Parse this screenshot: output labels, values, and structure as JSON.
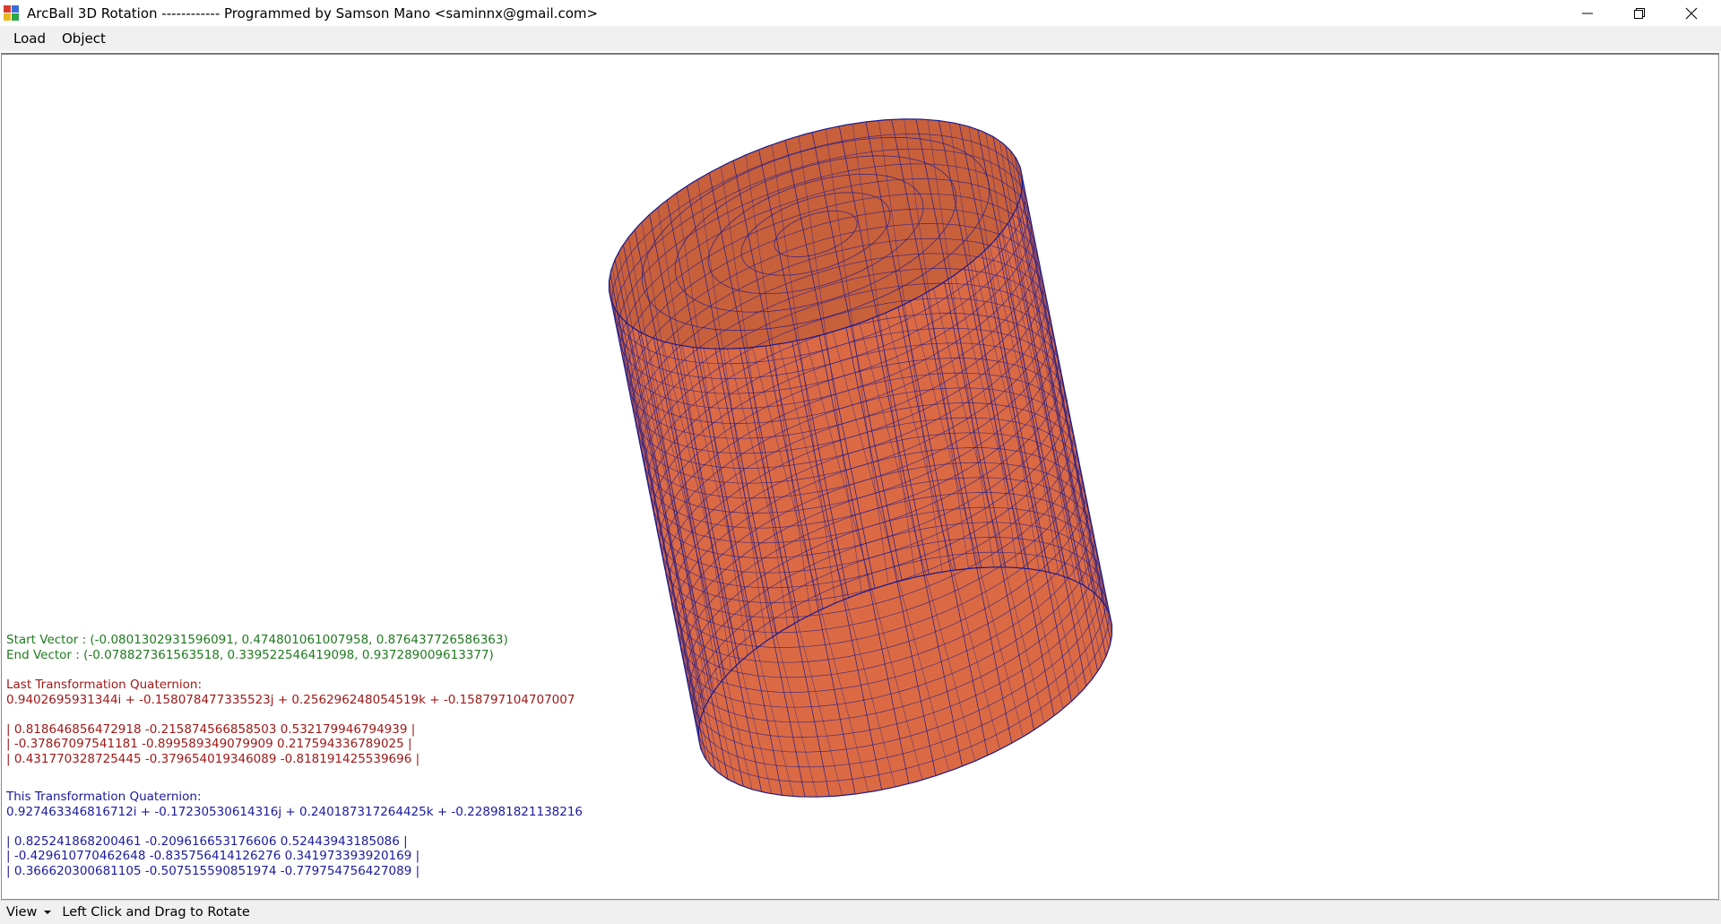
{
  "window": {
    "title": "ArcBall 3D Rotation ------------ Programmed by Samson Mano <saminnx@gmail.com>",
    "controls": {
      "minimize": "minimize-icon",
      "maximize": "restore-icon",
      "close": "close-icon"
    }
  },
  "menu": {
    "items": [
      "Load",
      "Object"
    ]
  },
  "readout": {
    "start_vector": "Start Vector : (-0.0801302931596091, 0.474801061007958, 0.876437726586363)",
    "end_vector": "End Vector : (-0.078827361563518, 0.339522546419098, 0.937289009613377)",
    "last_heading": "Last Transformation Quaternion:",
    "last_quaternion": "0.9402695931344i + -0.158078477335523j + 0.256296248054519k + -0.158797104707007",
    "last_matrix": [
      "| 0.818646856472918 -0.215874566858503 0.532179946794939 |",
      "| -0.37867097541181 -0.899589349079909 0.217594336789025 |",
      "| 0.431770328725445 -0.379654019346089 -0.818191425539696 |"
    ],
    "this_heading": "This Transformation Quaternion:",
    "this_quaternion": "0.927463346816712i + -0.17230530614316j + 0.240187317264425k + -0.228981821138216",
    "this_matrix": [
      "| 0.825241868200461 -0.209616653176606 0.52443943185086 |",
      "| -0.429610770462648 -0.835756414126276 0.341973393920169 |",
      "| 0.366620300681105 -0.507515590851974 -0.779754756427089 |"
    ]
  },
  "statusbar": {
    "dropdown": "View",
    "hint": "Left Click and Drag to Rotate"
  },
  "colors": {
    "mesh_fill": "#d9623a",
    "mesh_line": "#1a1a8c",
    "green_text": "#1f7a1f",
    "red_text": "#a01818",
    "blue_text": "#1a1aa0"
  }
}
